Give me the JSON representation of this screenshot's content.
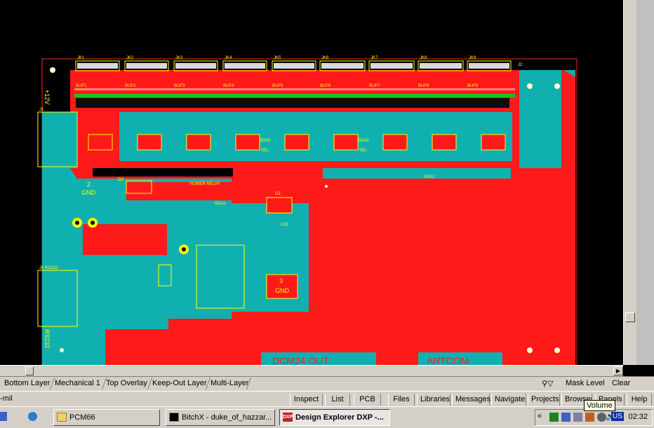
{
  "layer_tabs": [
    "Bottom Layer",
    "Mechanical 1",
    "Top Overlay",
    "Keep-Out Layer",
    "Multi-Layer"
  ],
  "mask_label": "Mask Level",
  "clear_label": "Clear",
  "status_text": "-mil",
  "panel_buttons": [
    "Inspect",
    "List",
    "PCB",
    "Files",
    "Libraries",
    "Messages",
    "Navigate",
    "Projects",
    "Browser",
    "Panels",
    "Help"
  ],
  "taskbar": {
    "items": [
      "PCM66",
      "BitchX - duke_of_hazzar...",
      "Design Explorer DXP -..."
    ],
    "tray_us": "US",
    "clock": "02:32",
    "tooltip": "Volume"
  },
  "pcb": {
    "connector_labels": [
      "JK1",
      "JK2",
      "JK3",
      "JK4",
      "JK5",
      "JK6",
      "JK7",
      "JK8",
      "JK9"
    ],
    "buffer_labels": [
      "BUF1",
      "BUF2",
      "BUF3",
      "BUF4",
      "BUF5",
      "BUF6",
      "BUF7",
      "BUF8",
      "BUF9"
    ],
    "labels": {
      "v12": "+12V",
      "j1": "J1",
      "gnd2_num": "2",
      "gnd2": "GND",
      "gnd3_num": "3",
      "gnd3": "GND",
      "d3": "D3",
      "d2": "D2",
      "power_relay": "POWER RELAY",
      "sda1": "SDA1",
      "sda2a": "SDA2",
      "sda2b": "SDA2",
      "sel1": "SEL",
      "sel2": "SEL",
      "sdao": "SDA0",
      "j6": "J6 RS232",
      "rs232": "RS232",
      "j2": "J2",
      "ld1": "LD1",
      "bottom1": "DCM24 OUT",
      "bottom2": "ARTCOM"
    }
  }
}
